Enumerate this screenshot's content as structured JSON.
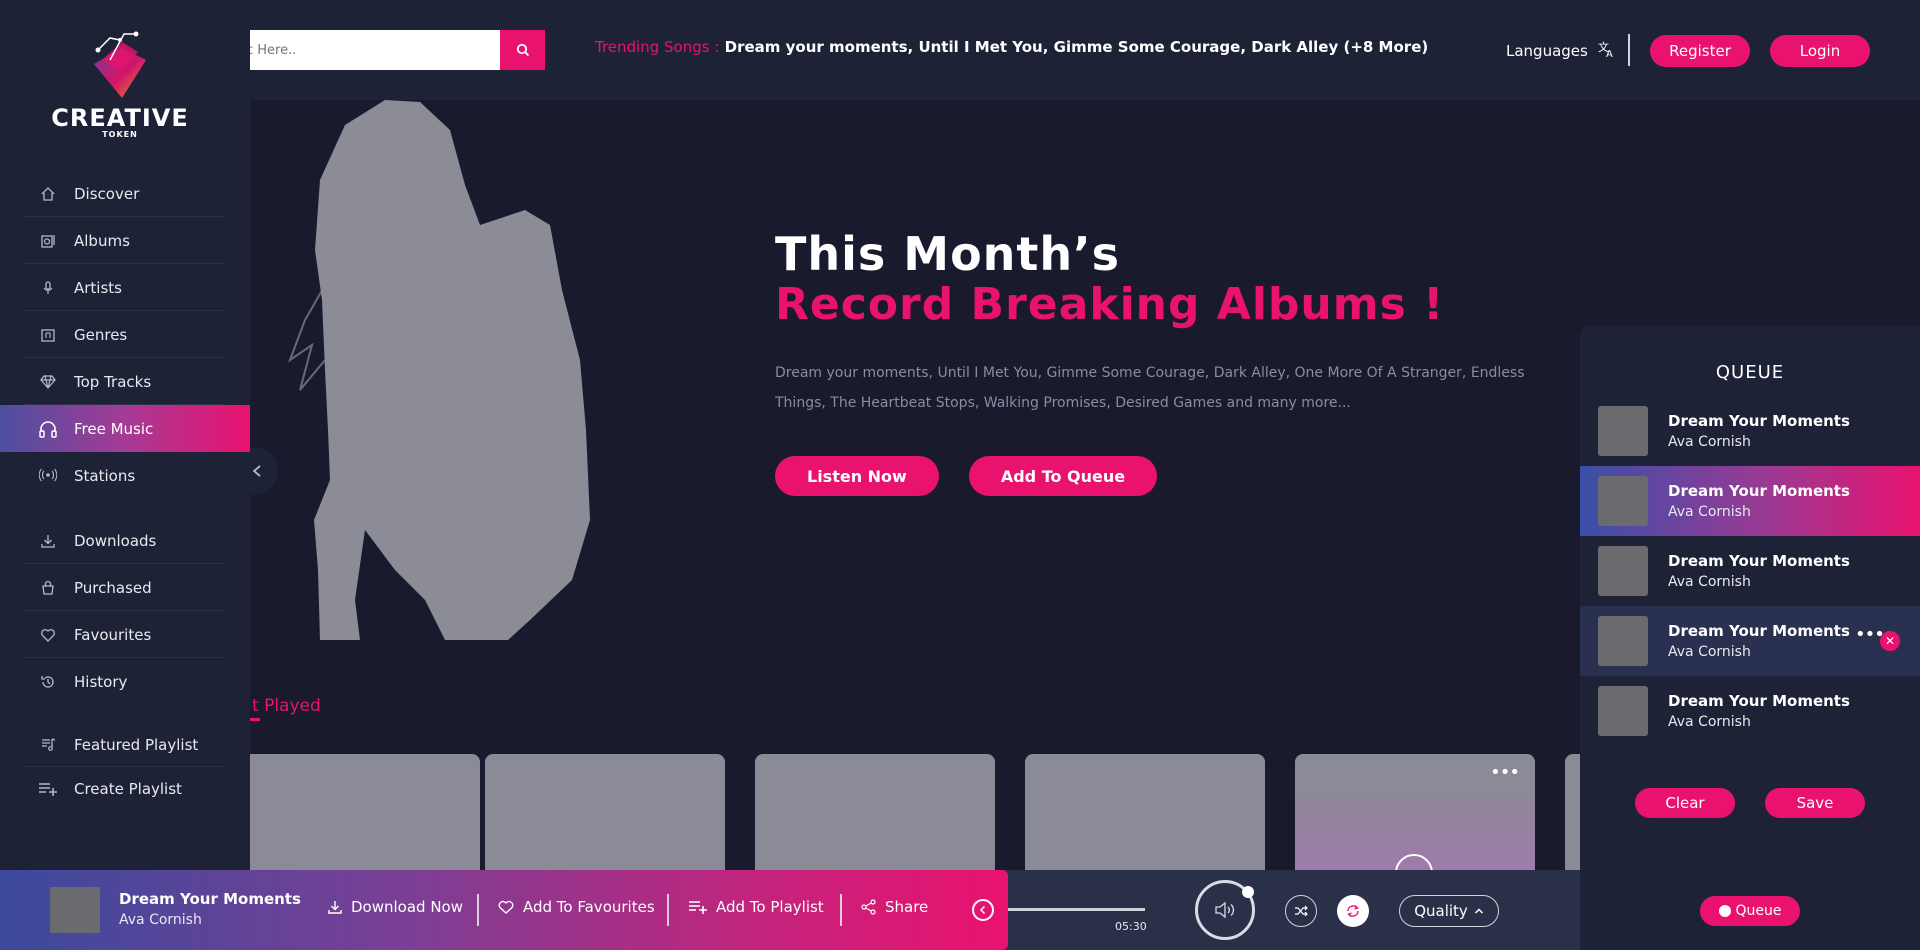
{
  "brand": {
    "name": "CREATIVE",
    "sub": "TOKEN"
  },
  "sidebar": {
    "items": [
      {
        "label": "Discover",
        "icon": "home-icon"
      },
      {
        "label": "Albums",
        "icon": "album-icon"
      },
      {
        "label": "Artists",
        "icon": "microphone-icon"
      },
      {
        "label": "Genres",
        "icon": "genre-icon"
      },
      {
        "label": "Top Tracks",
        "icon": "diamond-icon"
      },
      {
        "label": "Free Music",
        "icon": "headphones-icon",
        "active": true
      },
      {
        "label": "Stations",
        "icon": "broadcast-icon"
      },
      {
        "label": "Downloads",
        "icon": "download-icon"
      },
      {
        "label": "Purchased",
        "icon": "bag-icon"
      },
      {
        "label": "Favourites",
        "icon": "heart-icon"
      },
      {
        "label": "History",
        "icon": "history-icon"
      },
      {
        "label": "Featured Playlist",
        "icon": "playlist-icon"
      },
      {
        "label": "Create Playlist",
        "icon": "add-playlist-icon"
      }
    ]
  },
  "header": {
    "search_placeholder": "c Here..",
    "trending_label": "Trending Songs :",
    "trending_songs": "Dream your moments, Until I Met You, Gimme Some Courage, Dark Alley (+8 More)",
    "languages": "Languages",
    "register": "Register",
    "login": "Login"
  },
  "hero": {
    "title_line1": "This Month’s",
    "title_line2": "Record Breaking Albums !",
    "description": "Dream your moments, Until I Met You, Gimme Some Courage, Dark Alley, One More Of A Stranger, Endless Things, The Heartbeat Stops, Walking Promises, Desired Games and many more...",
    "listen_now": "Listen Now",
    "add_to_queue": "Add To Queue"
  },
  "recently": {
    "title_visible": "t Played"
  },
  "queue": {
    "title": "QUEUE",
    "items": [
      {
        "song": "Dream Your Moments",
        "artist": "Ava Cornish"
      },
      {
        "song": "Dream Your Moments",
        "artist": "Ava Cornish",
        "active": true
      },
      {
        "song": "Dream Your Moments",
        "artist": "Ava Cornish"
      },
      {
        "song": "Dream Your Moments",
        "artist": "Ava Cornish",
        "hover": true
      },
      {
        "song": "Dream Your Moments",
        "artist": "Ava Cornish"
      }
    ],
    "clear": "Clear",
    "save": "Save",
    "toggle": "Queue"
  },
  "player": {
    "song": "Dream Your Moments",
    "artist": "Ava Cornish",
    "download": "Download Now",
    "favourites": "Add To Favourites",
    "playlist": "Add To Playlist",
    "share": "Share",
    "time": "05:30",
    "quality": "Quality"
  },
  "colors": {
    "accent": "#e9126f",
    "sidebar": "#1e2237",
    "background": "#191a2e"
  }
}
